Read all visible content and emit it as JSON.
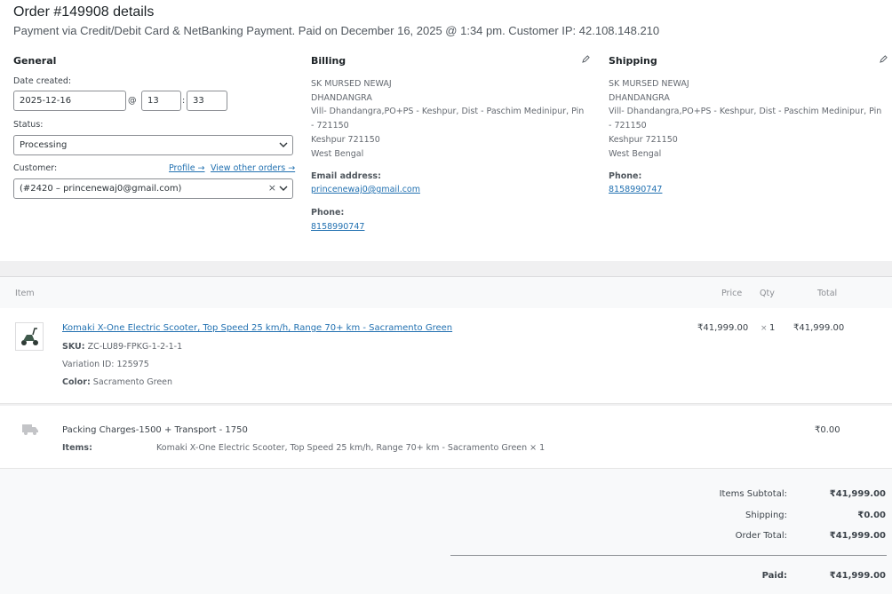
{
  "order": {
    "title": "Order #149908 details",
    "meta": "Payment via Credit/Debit Card & NetBanking Payment. Paid on December 16, 2025 @ 1:34 pm. Customer IP: 42.108.148.210"
  },
  "general": {
    "title": "General",
    "date_label": "Date created:",
    "date_value": "2025-12-16",
    "at": "@",
    "hour": "13",
    "colon": ":",
    "minute": "33",
    "status_label": "Status:",
    "status_value": "Processing",
    "customer_label": "Customer:",
    "profile_link": "Profile →",
    "other_orders_link": "View other orders →",
    "customer_value": "(#2420 – princenewaj0@gmail.com)",
    "clear_symbol": "×"
  },
  "billing": {
    "title": "Billing",
    "lines": [
      "SK MURSED NEWAJ",
      "DHANDANGRA",
      "Vill- Dhandangra,PO+PS - Keshpur, Dist - Paschim Medinipur, Pin",
      "- 721150",
      "Keshpur 721150",
      "West Bengal"
    ],
    "email_label": "Email address:",
    "email": "princenewaj0@gmail.com",
    "phone_label": "Phone:",
    "phone": "8158990747"
  },
  "shipping": {
    "title": "Shipping",
    "lines": [
      "SK MURSED NEWAJ",
      "DHANDANGRA",
      "Vill- Dhandangra,PO+PS - Keshpur, Dist - Paschim Medinipur, Pin",
      "- 721150",
      "Keshpur 721150",
      "West Bengal"
    ],
    "phone_label": "Phone:",
    "phone": "8158990747"
  },
  "items_header": {
    "item": "Item",
    "price": "Price",
    "qty": "Qty",
    "total": "Total"
  },
  "line_item": {
    "name": "Komaki X-One Electric Scooter, Top Speed 25 km/h, Range 70+ km - Sacramento Green",
    "sku_label": "SKU:",
    "sku": "ZC-LU89-FPKG-1-2-1-1",
    "variation_label": "Variation ID:",
    "variation": "125975",
    "color_label": "Color:",
    "color": "Sacramento Green",
    "price": "₹41,999.00",
    "qty_x": "×",
    "qty": "1",
    "total": "₹41,999.00"
  },
  "shipping_item": {
    "name": "Packing Charges-1500 + Transport - 1750",
    "items_label": "Items:",
    "items": "Komaki X-One Electric Scooter, Top Speed 25 km/h, Range 70+ km - Sacramento Green × 1",
    "total": "₹0.00"
  },
  "totals": {
    "subtotal_label": "Items Subtotal:",
    "subtotal": "₹41,999.00",
    "shipping_label": "Shipping:",
    "shipping": "₹0.00",
    "order_total_label": "Order Total:",
    "order_total": "₹41,999.00",
    "paid_label": "Paid:",
    "paid": "₹41,999.00"
  }
}
